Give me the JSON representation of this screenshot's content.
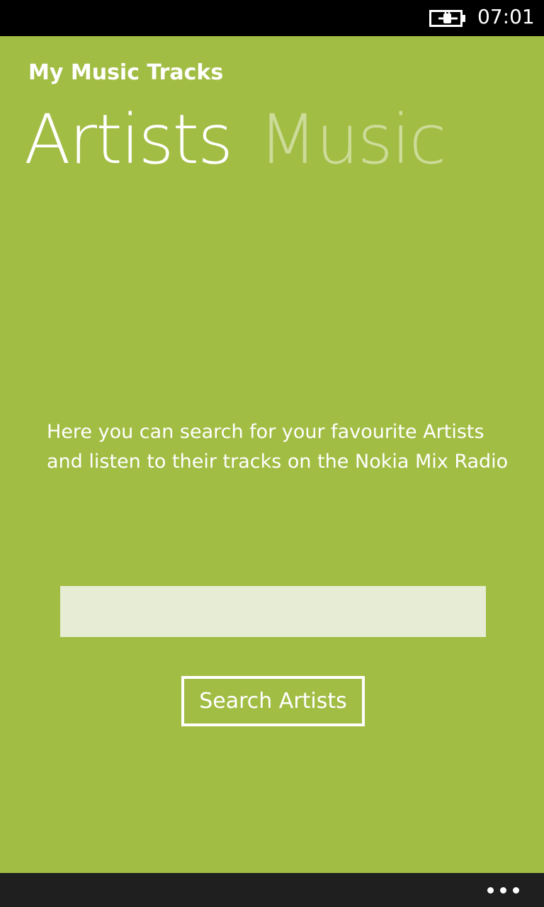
{
  "status_bar": {
    "time": "07:01",
    "battery_icon": "battery-charging-icon"
  },
  "app": {
    "title": "My Music Tracks",
    "pivot": {
      "items": [
        {
          "label": "Artists",
          "active": true
        },
        {
          "label": "Music",
          "active": false
        }
      ]
    },
    "description": "Here you can search for your favourite Artists and listen to their tracks on the Nokia Mix Radio",
    "search": {
      "value": "",
      "placeholder": ""
    },
    "search_button_label": "Search Artists"
  },
  "app_bar": {
    "more_icon": "ellipsis-icon"
  },
  "colors": {
    "accent": "#a2bd44",
    "input_background": "#e6edd4",
    "status_bar": "#000000",
    "app_bar": "#1f1f1f"
  }
}
